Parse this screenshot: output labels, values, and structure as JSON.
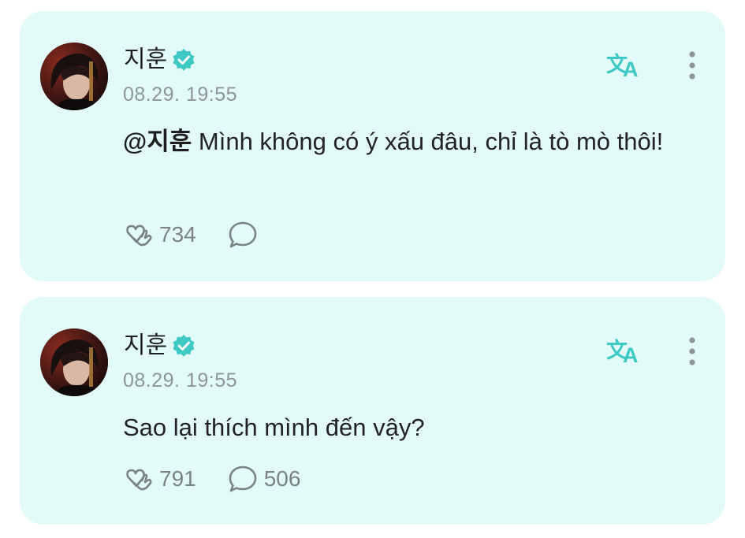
{
  "posts": [
    {
      "author": "지훈",
      "verified_icon": "verified-badge-icon",
      "time": "08.29. 19:55",
      "mention": "@지훈",
      "text": " Mình không có ý xấu đâu, chỉ là tò mò thôi!",
      "like_count": "734",
      "comment_count": ""
    },
    {
      "author": "지훈",
      "verified_icon": "verified-badge-icon",
      "time": "08.29. 19:55",
      "mention": "",
      "text": "Sao lại thích mình đến vậy?",
      "like_count": "791",
      "comment_count": "506"
    }
  ],
  "icons": {
    "translate": "translate-icon",
    "more": "more-vertical-icon",
    "like": "like-heart-hands-icon",
    "comment": "comment-bubble-icon"
  },
  "colors": {
    "card_background": "#e3fbf8",
    "accent": "#3ec9c4",
    "icon_gray": "#7b8383",
    "timestamp": "#8e9595"
  }
}
